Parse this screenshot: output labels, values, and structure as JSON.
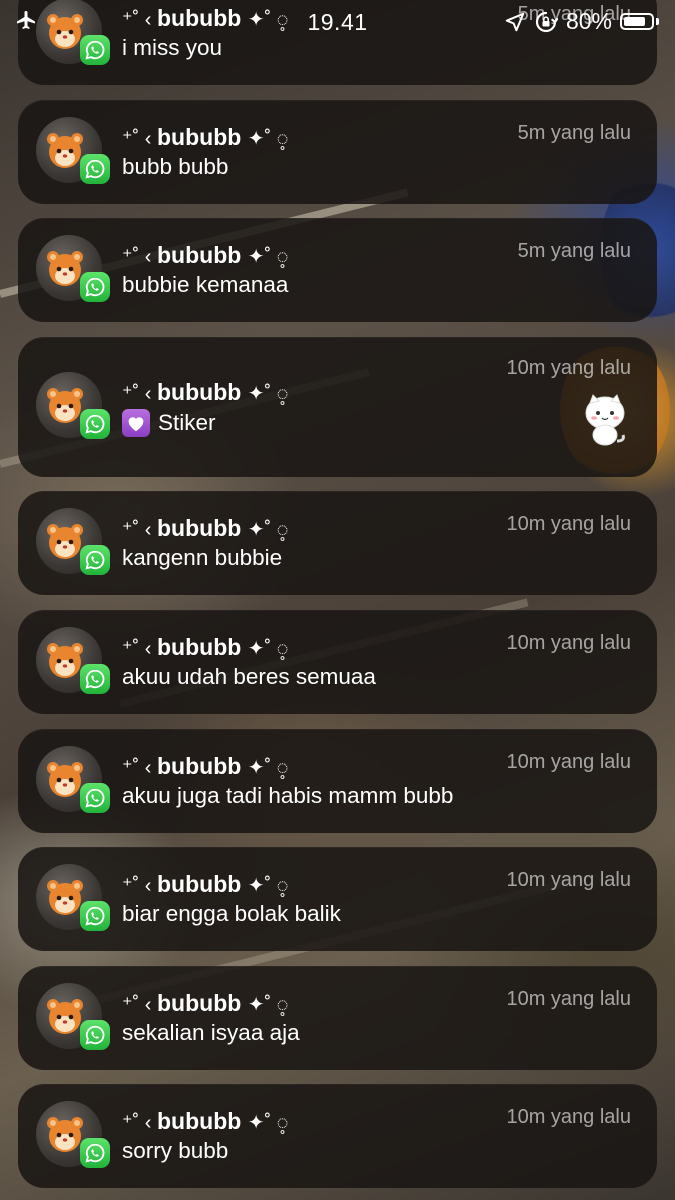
{
  "status_bar": {
    "time": "19.41",
    "battery": "80%",
    "battery_level": 0.8,
    "icons": [
      "airplane-icon",
      "location-arrow-icon",
      "rotation-lock-icon",
      "battery-icon"
    ]
  },
  "app_icon": "whatsapp-icon",
  "notifications": [
    {
      "sender": "bububb",
      "time": "5m yang lalu",
      "message": "i miss you"
    },
    {
      "sender": "bububb",
      "time": "5m yang lalu",
      "message": "bubb bubb"
    },
    {
      "sender": "bububb",
      "time": "5m yang lalu",
      "message": "bubbie kemanaa"
    },
    {
      "sender": "bububb",
      "time": "10m yang lalu",
      "message": "Stiker",
      "message_icon": "purple-heart-icon",
      "attachment_icon": "cat-sticker-icon"
    },
    {
      "sender": "bububb",
      "time": "10m yang lalu",
      "message": "kangenn bubbie"
    },
    {
      "sender": "bububb",
      "time": "10m yang lalu",
      "message": "akuu udah beres semuaa"
    },
    {
      "sender": "bububb",
      "time": "10m yang lalu",
      "message": "akuu juga tadi habis mamm bubb"
    },
    {
      "sender": "bububb",
      "time": "10m yang lalu",
      "message": "biar engga bolak balik"
    },
    {
      "sender": "bububb",
      "time": "10m yang lalu",
      "message": "sekalian isyaa aja"
    },
    {
      "sender": "bububb",
      "time": "10m yang lalu",
      "message": "sorry bubb"
    }
  ],
  "sender_decor": {
    "prefix": "⁺˚ ‹",
    "suffix": "✦˚ ◌̥"
  }
}
